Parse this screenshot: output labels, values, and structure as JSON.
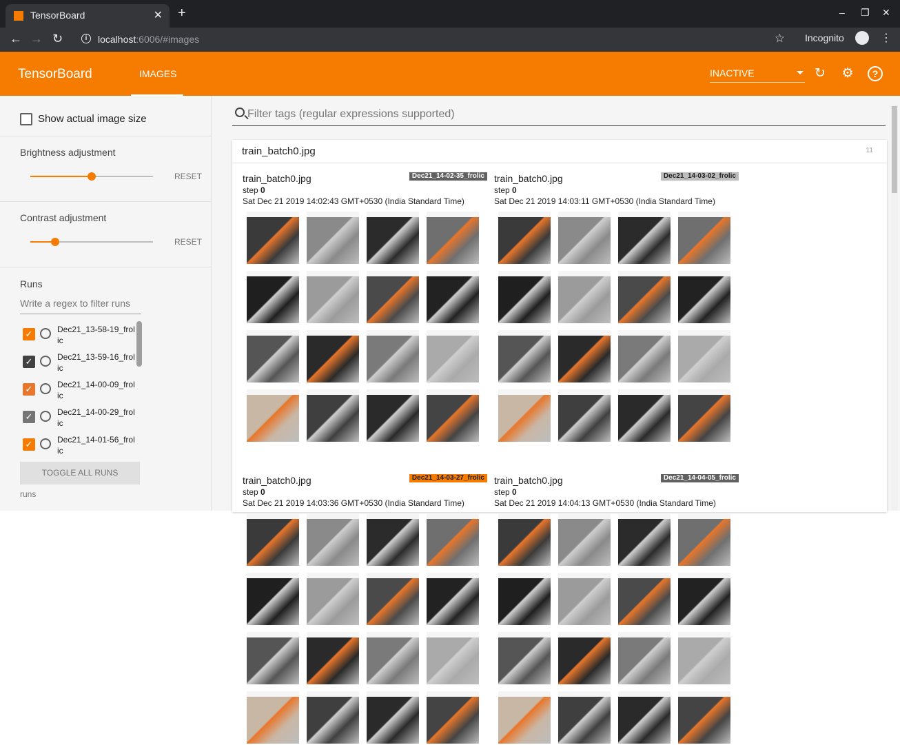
{
  "browser": {
    "tab_title": "TensorBoard",
    "tab_close": "✕",
    "new_tab": "+",
    "window_controls": [
      "–",
      "❐",
      "✕"
    ],
    "url_host": "localhost",
    "url_path": ":6006/#images",
    "incognito_label": "Incognito"
  },
  "app": {
    "brand": "TensorBoard",
    "active_tab": "IMAGES",
    "reload_dropdown": "INACTIVE",
    "accent_color": "#f57c00"
  },
  "sidebar": {
    "show_actual_size_label": "Show actual image size",
    "brightness": {
      "label": "Brightness adjustment",
      "value": 0.5,
      "reset": "RESET"
    },
    "contrast": {
      "label": "Contrast adjustment",
      "value": 0.2,
      "reset": "RESET"
    },
    "runs_title": "Runs",
    "regex_placeholder": "Write a regex to filter runs",
    "runs": [
      {
        "name": "Dec21_13-58-19_frolic",
        "checked": true,
        "color": "#f57c00"
      },
      {
        "name": "Dec21_13-59-16_frolic",
        "checked": true,
        "color": "#424242"
      },
      {
        "name": "Dec21_14-00-09_frolic",
        "checked": true,
        "color": "#e8762b"
      },
      {
        "name": "Dec21_14-00-29_frolic",
        "checked": true,
        "color": "#757575"
      },
      {
        "name": "Dec21_14-01-56_frolic",
        "checked": true,
        "color": "#f57c00"
      }
    ],
    "toggle_all_label": "TOGGLE ALL RUNS",
    "footer": "runs"
  },
  "main": {
    "filter_placeholder": "Filter tags (regular expressions supported)",
    "tag_pane": {
      "name": "train_batch0.jpg",
      "count": "11"
    },
    "cards": [
      {
        "title": "train_batch0.jpg",
        "step_label": "step",
        "step": "0",
        "timestamp": "Sat Dec 21 2019 14:02:43 GMT+0530 (India Standard Time)",
        "run": "Dec21_14-02-35_frolic",
        "badge_color": "#616161",
        "badge_text_color": "#ffffff"
      },
      {
        "title": "train_batch0.jpg",
        "step_label": "step",
        "step": "0",
        "timestamp": "Sat Dec 21 2019 14:03:11 GMT+0530 (India Standard Time)",
        "run": "Dec21_14-03-02_frolic",
        "badge_color": "#bdbdbd",
        "badge_text_color": "#212121"
      },
      {
        "title": "train_batch0.jpg",
        "step_label": "step",
        "step": "0",
        "timestamp": "Sat Dec 21 2019 14:03:36 GMT+0530 (India Standard Time)",
        "run": "Dec21_14-03-27_frolic",
        "badge_color": "#f57c00",
        "badge_text_color": "#212121"
      },
      {
        "title": "train_batch0.jpg",
        "step_label": "step",
        "step": "0",
        "timestamp": "Sat Dec 21 2019 14:04:13 GMT+0530 (India Standard Time)",
        "run": "Dec21_14-04-05_frolic",
        "badge_color": "#616161",
        "badge_text_color": "#ffffff"
      }
    ]
  }
}
